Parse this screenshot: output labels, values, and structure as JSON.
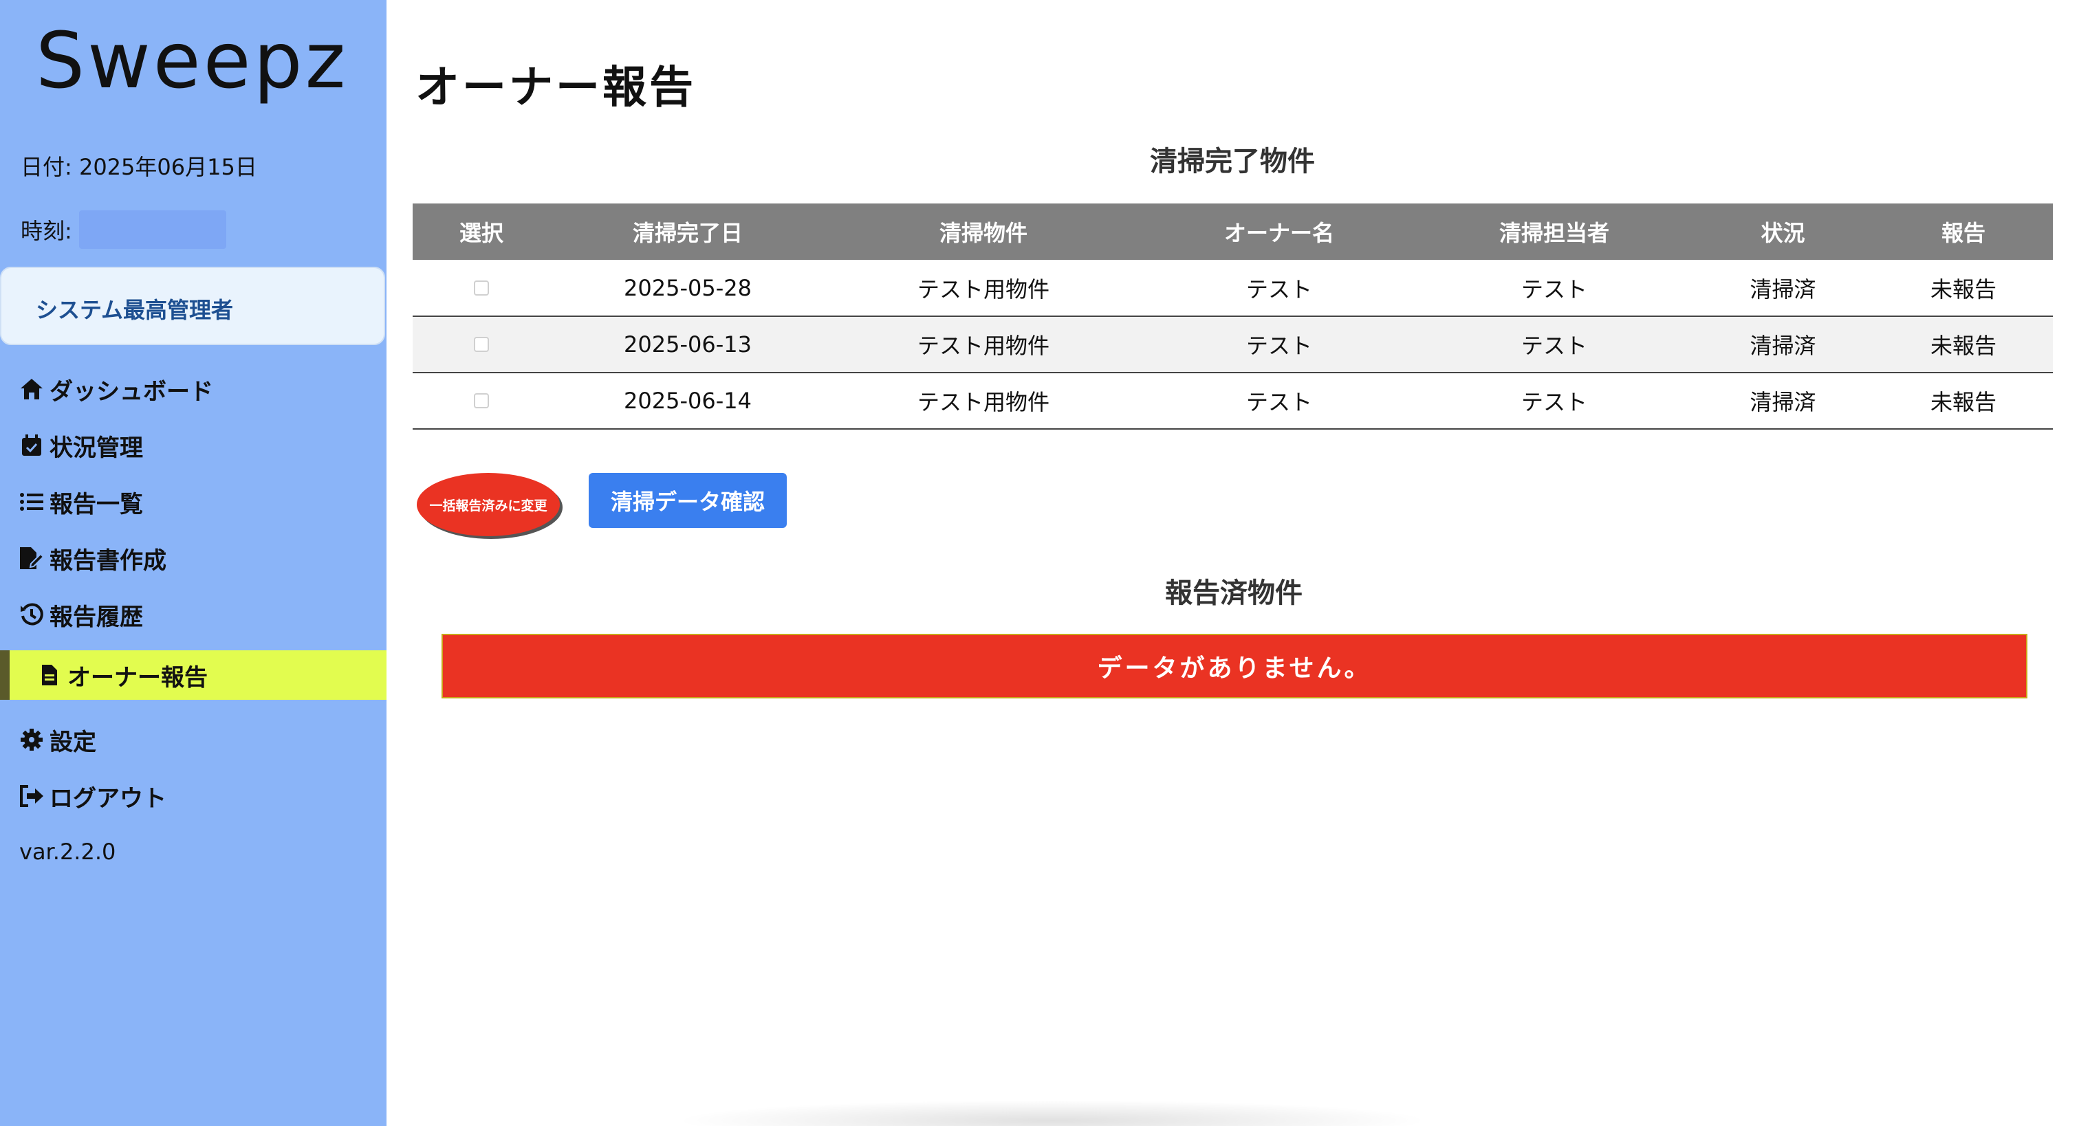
{
  "sidebar": {
    "logo": "Sweepz",
    "date_label": "日付: 2025年06月15日",
    "time_label": "時刻:",
    "role": "システム最高管理者",
    "nav": [
      {
        "label": "ダッシュボード",
        "icon": "home-icon"
      },
      {
        "label": "状況管理",
        "icon": "calendar-check-icon"
      },
      {
        "label": "報告一覧",
        "icon": "list-icon"
      },
      {
        "label": "報告書作成",
        "icon": "file-edit-icon"
      },
      {
        "label": "報告履歴",
        "icon": "history-icon"
      },
      {
        "label": "オーナー報告",
        "icon": "file-icon",
        "active": true
      },
      {
        "label": "設定",
        "icon": "gear-icon"
      },
      {
        "label": "ログアウト",
        "icon": "logout-icon"
      }
    ],
    "version": "var.2.2.0"
  },
  "main": {
    "title": "オーナー報告",
    "completed_section_title": "清掃完了物件",
    "table": {
      "headers": [
        "選択",
        "清掃完了日",
        "清掃物件",
        "オーナー名",
        "清掃担当者",
        "状況",
        "報告"
      ],
      "rows": [
        {
          "date": "2025-05-28",
          "property": "テスト用物件",
          "owner": "テスト",
          "staff": "テスト",
          "status": "清掃済",
          "report": "未報告"
        },
        {
          "date": "2025-06-13",
          "property": "テスト用物件",
          "owner": "テスト",
          "staff": "テスト",
          "status": "清掃済",
          "report": "未報告"
        },
        {
          "date": "2025-06-14",
          "property": "テスト用物件",
          "owner": "テスト",
          "staff": "テスト",
          "status": "清掃済",
          "report": "未報告"
        }
      ]
    },
    "bulk_button": "一括報告済みに変更",
    "confirm_button": "清掃データ確認",
    "reported_section_title": "報告済物件",
    "no_data": "データがありません。"
  },
  "colors": {
    "sidebar_bg": "#8ab4f8",
    "active_nav_bg": "#e2fc4f",
    "danger": "#ea3323",
    "primary": "#3a7fef",
    "table_header_bg": "#808080"
  }
}
